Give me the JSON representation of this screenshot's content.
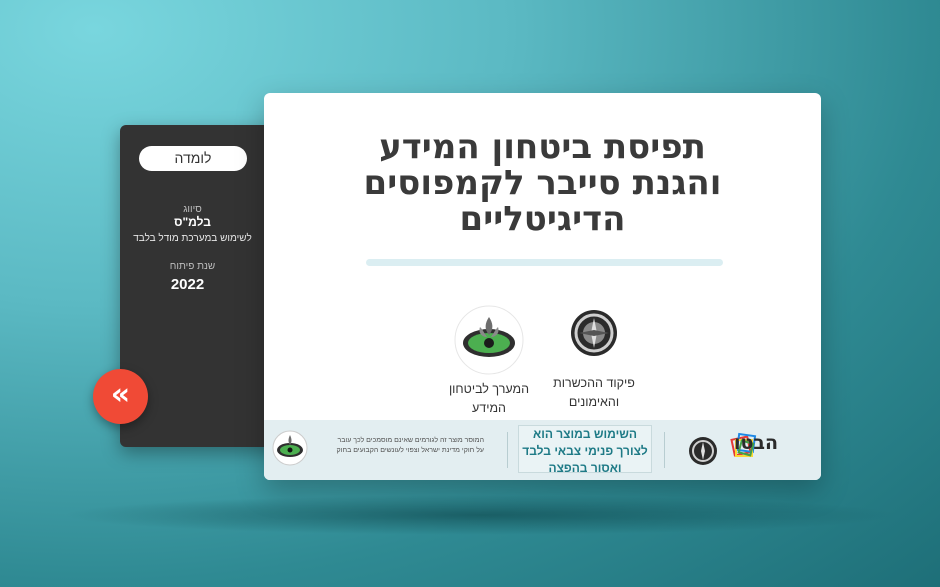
{
  "side_panel": {
    "tag": "לומדה",
    "classification_label": "סיווג",
    "classification_value": "בלמ\"ס",
    "classification_note": "לשימוש במערכת מודל בלבד",
    "year_label": "שנת פיתוח",
    "year_value": "2022",
    "back_button": "«"
  },
  "card": {
    "title_line1": "תפיסת ביטחון המידע",
    "title_line2": "והגנת סייבר לקמפוסים",
    "title_line3": "הדיגיטליים",
    "org1_line1": "פיקוד ההכשרות",
    "org1_line2": "והאימונים",
    "org2_line1": "המערך לביטחון",
    "org2_line2": "המידע"
  },
  "footer": {
    "notice_line1": "השימוש במוצר הוא",
    "notice_line2": "לצורך פנימי צבאי בלבד",
    "notice_line3": "ואסור בהפצה",
    "legal_line1": "המוסר מוצר זה לגורמים שאינם מוסמכים לכך עובר",
    "legal_line2": "על חוקי מדינת ישראל וצפוי לעונשים הקבועים בחוק",
    "brand": "הבטו"
  },
  "colors": {
    "accent_red": "#f04a36",
    "panel_dark": "#333333",
    "notice_teal": "#1e7a86"
  }
}
